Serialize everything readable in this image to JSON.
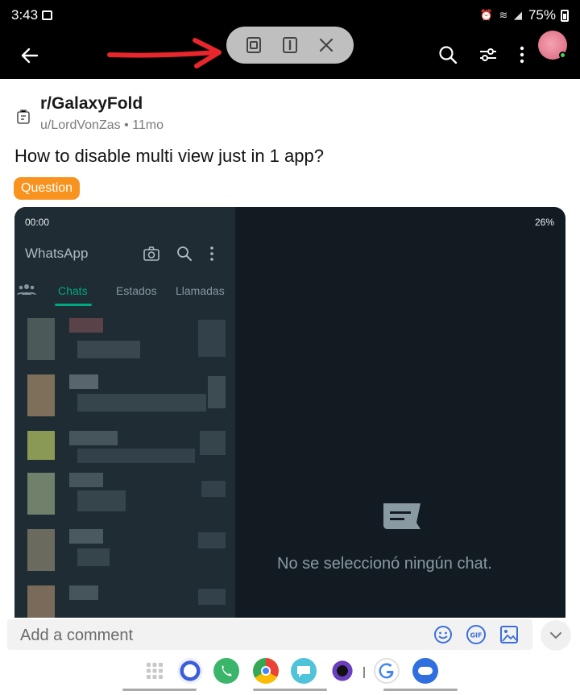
{
  "status_bar": {
    "time": "3:43",
    "battery": "75%"
  },
  "post": {
    "subreddit": "r/GalaxyFold",
    "author": "u/LordVonZas",
    "age": "11mo",
    "title": "How to disable multi view just in 1 app?",
    "flair": "Question"
  },
  "embedded": {
    "time": "00:00",
    "battery": "26%",
    "app_title": "WhatsApp",
    "tabs": [
      "Chats",
      "Estados",
      "Llamadas"
    ],
    "empty_text": "No se seleccionó ningún chat."
  },
  "comment": {
    "placeholder": "Add a comment",
    "gif_label": "GIF"
  },
  "colors": {
    "flair": "#f7931e",
    "whatsapp_accent": "#00a884",
    "annotation_arrow": "#e8262b"
  },
  "icons": [
    "back-arrow-icon",
    "popup-view-icon",
    "split-view-icon",
    "close-icon",
    "search-icon",
    "filter-icon",
    "more-icon",
    "avatar"
  ]
}
